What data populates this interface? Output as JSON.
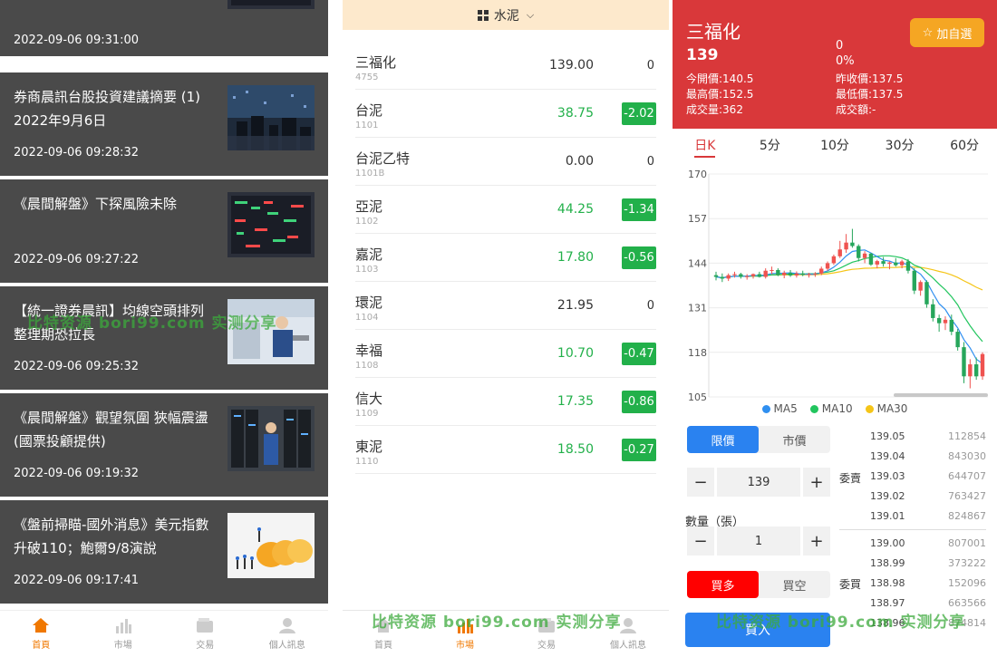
{
  "news": {
    "items": [
      {
        "title": "",
        "time": "2022-09-06 09:31:00"
      },
      {
        "title": "券商晨訊台股投資建議摘要 (1) 2022年9月6日",
        "time": "2022-09-06 09:28:32"
      },
      {
        "title": "《晨間解盤》下探風險未除",
        "time": "2022-09-06 09:27:22"
      },
      {
        "title": "【統一證券晨訊】均線空頭排列 整理期恐拉長",
        "time": "2022-09-06 09:25:32"
      },
      {
        "title": "《晨間解盤》觀望氛圍 狹幅震盪(國票投顧提供)",
        "time": "2022-09-06 09:19:32"
      },
      {
        "title": "《盤前掃瞄-國外消息》美元指數升破110；鮑爾9/8演說",
        "time": "2022-09-06 09:17:41"
      }
    ]
  },
  "tabbar": {
    "home": "首頁",
    "market": "市場",
    "trade": "交易",
    "profile": "個人訊息"
  },
  "market": {
    "category": "水泥",
    "rows": [
      {
        "name": "三福化",
        "code": "4755",
        "price": "139.00",
        "change": "0",
        "dir": "flat"
      },
      {
        "name": "台泥",
        "code": "1101",
        "price": "38.75",
        "change": "-2.02",
        "dir": "down"
      },
      {
        "name": "台泥乙特",
        "code": "1101B",
        "price": "0.00",
        "change": "0",
        "dir": "flat"
      },
      {
        "name": "亞泥",
        "code": "1102",
        "price": "44.25",
        "change": "-1.34",
        "dir": "down"
      },
      {
        "name": "嘉泥",
        "code": "1103",
        "price": "17.80",
        "change": "-0.56",
        "dir": "down"
      },
      {
        "name": "環泥",
        "code": "1104",
        "price": "21.95",
        "change": "0",
        "dir": "flat"
      },
      {
        "name": "幸福",
        "code": "1108",
        "price": "10.70",
        "change": "-0.47",
        "dir": "down"
      },
      {
        "name": "信大",
        "code": "1109",
        "price": "17.35",
        "change": "-0.86",
        "dir": "down"
      },
      {
        "name": "東泥",
        "code": "1110",
        "price": "18.50",
        "change": "-0.27",
        "dir": "down"
      }
    ]
  },
  "detail": {
    "name": "三福化",
    "price": "139",
    "change": "0",
    "change_pct": "0%",
    "open": "今開價:140.5",
    "prev_close": "昨收價:137.5",
    "high": "最高價:152.5",
    "low": "最低價:137.5",
    "volume": "成交量:362",
    "amount": "成交額:-",
    "watch_label": "加自選",
    "ktabs": [
      "日K",
      "5分",
      "10分",
      "30分",
      "60分"
    ],
    "legend": [
      "MA5",
      "MA10",
      "MA30"
    ],
    "order_type": {
      "limit": "限價",
      "market": "市價"
    },
    "price_input": "139",
    "qty_label": "數量（張）",
    "qty_input": "1",
    "side": {
      "buy": "買多",
      "sell": "買空"
    },
    "buy_button": "買入",
    "ask_label": "委賣",
    "bid_label": "委買",
    "asks": [
      {
        "price": "139.05",
        "qty": "112854"
      },
      {
        "price": "139.04",
        "qty": "843030"
      },
      {
        "price": "139.03",
        "qty": "644707"
      },
      {
        "price": "139.02",
        "qty": "763427"
      },
      {
        "price": "139.01",
        "qty": "824867"
      }
    ],
    "bids": [
      {
        "price": "139.00",
        "qty": "807001"
      },
      {
        "price": "138.99",
        "qty": "373222"
      },
      {
        "price": "138.98",
        "qty": "152096"
      },
      {
        "price": "138.97",
        "qty": "663566"
      },
      {
        "price": "138.96",
        "qty": "874814"
      }
    ]
  },
  "chart_data": {
    "type": "candlestick",
    "y_ticks": [
      170,
      157,
      144,
      131,
      118,
      105
    ],
    "ylim": [
      105,
      170
    ],
    "colors": {
      "up": "#ef5350",
      "down": "#26a65b",
      "ma5": "#2f8ff0",
      "ma10": "#22c55e",
      "ma30": "#f5c518"
    },
    "candles": [
      [
        140.5,
        141.5,
        139.0,
        140.0
      ],
      [
        140.0,
        141.0,
        138.5,
        139.5
      ],
      [
        139.5,
        141.0,
        138.8,
        140.5
      ],
      [
        140.5,
        141.5,
        139.8,
        140.8
      ],
      [
        140.8,
        141.2,
        139.5,
        140.0
      ],
      [
        140.0,
        140.8,
        139.2,
        140.2
      ],
      [
        140.2,
        141.0,
        139.5,
        140.8
      ],
      [
        140.8,
        141.5,
        139.8,
        140.0
      ],
      [
        140.0,
        142.5,
        139.5,
        141.8
      ],
      [
        141.8,
        143.0,
        140.8,
        142.0
      ],
      [
        142.0,
        142.5,
        140.2,
        140.5
      ],
      [
        140.5,
        141.8,
        139.6,
        141.2
      ],
      [
        141.2,
        142.0,
        140.0,
        140.4
      ],
      [
        140.4,
        141.6,
        139.8,
        141.0
      ],
      [
        141.0,
        141.8,
        140.2,
        140.6
      ],
      [
        140.6,
        141.2,
        139.8,
        140.8
      ],
      [
        140.8,
        141.4,
        140.0,
        141.0
      ],
      [
        141.0,
        143.0,
        140.5,
        142.4
      ],
      [
        142.4,
        144.5,
        141.8,
        144.0
      ],
      [
        144.0,
        146.5,
        143.5,
        146.0
      ],
      [
        146.0,
        150.5,
        145.5,
        148.0
      ],
      [
        148.0,
        152.5,
        147.0,
        150.0
      ],
      [
        150.0,
        154.0,
        148.5,
        149.0
      ],
      [
        149.0,
        149.5,
        144.5,
        145.5
      ],
      [
        145.5,
        147.5,
        144.0,
        146.8
      ],
      [
        146.8,
        147.0,
        143.2,
        143.6
      ],
      [
        143.6,
        145.0,
        142.5,
        144.6
      ],
      [
        144.6,
        145.8,
        143.0,
        143.8
      ],
      [
        143.8,
        144.5,
        142.2,
        144.2
      ],
      [
        144.2,
        145.5,
        143.0,
        143.4
      ],
      [
        143.4,
        145.0,
        142.5,
        144.5
      ],
      [
        144.5,
        145.2,
        141.0,
        141.8
      ],
      [
        141.8,
        142.5,
        135.0,
        136.0
      ],
      [
        136.0,
        139.0,
        134.5,
        138.5
      ],
      [
        138.5,
        139.0,
        131.0,
        132.0
      ],
      [
        132.0,
        133.5,
        127.0,
        128.0
      ],
      [
        128.0,
        129.0,
        124.0,
        126.5
      ],
      [
        126.5,
        128.5,
        124.5,
        127.5
      ],
      [
        127.5,
        129.0,
        123.0,
        124.0
      ],
      [
        124.0,
        124.8,
        118.5,
        119.5
      ],
      [
        119.5,
        121.0,
        109.0,
        111.0
      ],
      [
        111.0,
        116.0,
        107.5,
        114.5
      ],
      [
        114.5,
        116.5,
        110.0,
        111.0
      ],
      [
        111.0,
        118.0,
        110.0,
        117.5
      ]
    ]
  }
}
